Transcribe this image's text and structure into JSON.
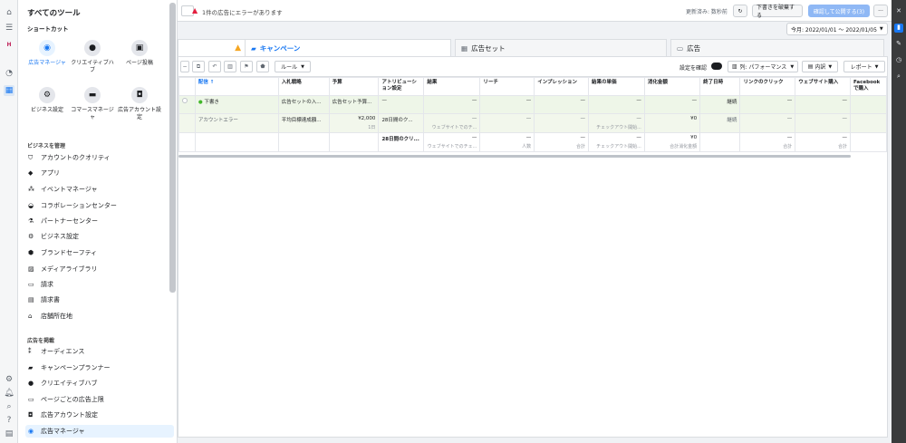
{
  "tools": {
    "title": "すべてのツール",
    "shortcuts_label": "ショートカット",
    "shortcuts": [
      {
        "label": "広告マネージャ",
        "icon": "gauge-icon"
      },
      {
        "label": "クリエイティブハブ",
        "icon": "palette-icon"
      },
      {
        "label": "ページ投稿",
        "icon": "page-icon"
      },
      {
        "label": "ビジネス設定",
        "icon": "gear-icon"
      },
      {
        "label": "コマースマネージャ",
        "icon": "cart-icon"
      },
      {
        "label": "広告アカウント設定",
        "icon": "ad-account-icon"
      }
    ],
    "manage_label": "ビジネスを管理",
    "manage_items": [
      "アカウントのクオリティ",
      "アプリ",
      "イベントマネージャ",
      "コラボレーションセンター",
      "パートナーセンター",
      "ビジネス設定",
      "ブランドセーフティ",
      "メディアライブラリ",
      "請求",
      "請求書",
      "店舗所在地"
    ],
    "ads_label": "広告を掲載",
    "ads_items": [
      "オーディエンス",
      "キャンペーンプランナー",
      "クリエイティブハブ",
      "ページごとの広告上限",
      "広告アカウント設定",
      "広告マネージャ"
    ]
  },
  "topbar": {
    "error_text": "1件の広告にエラーがあります",
    "updated": "更新済み: 数秒前",
    "discard": "下書きを破棄する",
    "publish": "確認して公開する(3)",
    "more": "···"
  },
  "datebar": {
    "range": "今月: 2022/01/01 ～ 2022/01/05"
  },
  "tabs": [
    {
      "label": "キャンペーン",
      "icon": "folder-icon"
    },
    {
      "label": "広告セット",
      "icon": "grid-icon"
    },
    {
      "label": "広告",
      "icon": "ad-icon"
    }
  ],
  "toolbar": {
    "rule": "ルール",
    "review_settings": "設定を確認",
    "columns": "列: パフォーマンス",
    "breakdown": "内訳",
    "reports": "レポート"
  },
  "table": {
    "headers": [
      "配信 ↑",
      "入札戦略",
      "予算",
      "アトリビューション設定",
      "結果",
      "リーチ",
      "インプレッション",
      "結果の単価",
      "消化金額",
      "終了日時",
      "リンクのクリック",
      "ウェブサイト購入",
      "Facebookで購入"
    ],
    "rows": [
      {
        "cells": [
          "下書き",
          "広告セットの入...",
          "広告セット予算...",
          "—",
          "—",
          "—",
          "—",
          "—",
          "—",
          "継続",
          "—",
          "—",
          ""
        ],
        "subs": [
          "",
          "",
          "",
          "",
          "",
          "",
          "",
          "",
          "",
          "",
          "",
          "",
          ""
        ]
      },
      {
        "cells": [
          "アカウントエラー",
          "平均目標達成額...",
          "¥2,000",
          "28日間のク...",
          "—",
          "—",
          "—",
          "—",
          "¥0",
          "継続",
          "—",
          "—",
          ""
        ],
        "subs": [
          "",
          "",
          "1日",
          "",
          "ウェブサイトでのチ...",
          "",
          "",
          "チェックアウト開始...",
          "",
          "",
          "",
          "",
          ""
        ]
      },
      {
        "cells": [
          "",
          "",
          "",
          "28日間のクリ...",
          "—",
          "—",
          "—",
          "—",
          "¥0",
          "",
          "—",
          "—",
          ""
        ],
        "subs": [
          "",
          "",
          "",
          "",
          "ウェブサイトでのチェ...",
          "人数",
          "合計",
          "チェックアウト開始...",
          "合計消化金額",
          "",
          "合計",
          "合計",
          ""
        ]
      }
    ]
  }
}
